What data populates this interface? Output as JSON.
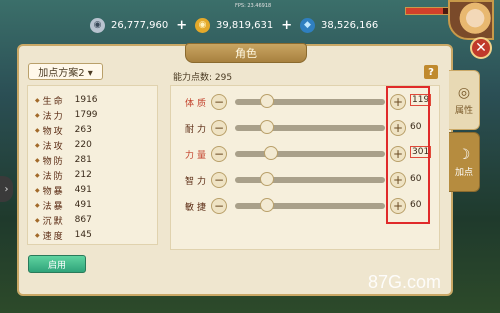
{
  "hud": {
    "fps_text": "FPS: 23.46918",
    "resources": [
      {
        "icon": "silver-coin-icon",
        "glyph": "◉",
        "color": "#b8c3cf",
        "value": "26,777,960"
      },
      {
        "icon": "gold-coin-icon",
        "glyph": "◉",
        "color": "#e4a92a",
        "value": "39,819,631"
      },
      {
        "icon": "diamond-icon",
        "glyph": "◆",
        "color": "#4aa8e0",
        "value": "38,526,166"
      }
    ],
    "plus_glyph": "+"
  },
  "panel": {
    "title": "角色",
    "close_glyph": "✕",
    "side_tabs": [
      {
        "label": "属性",
        "glyph": "◎",
        "active": false
      },
      {
        "label": "加点",
        "glyph": "☽",
        "active": true
      }
    ],
    "plan_select": "加点方案2 ▾",
    "stats": [
      {
        "name": "生命",
        "value": "1916"
      },
      {
        "name": "法力",
        "value": "1799"
      },
      {
        "name": "物攻",
        "value": "263"
      },
      {
        "name": "法攻",
        "value": "220"
      },
      {
        "name": "物防",
        "value": "281"
      },
      {
        "name": "法防",
        "value": "212"
      },
      {
        "name": "物暴",
        "value": "491"
      },
      {
        "name": "法暴",
        "value": "491"
      },
      {
        "name": "沉默",
        "value": "867"
      },
      {
        "name": "速度",
        "value": "145"
      }
    ],
    "ability_points_label": "能力点数: 295",
    "help_glyph": "?",
    "attributes": [
      {
        "name": "体质",
        "value": "119",
        "level": 0.33,
        "highlight": true
      },
      {
        "name": "耐力",
        "value": "60",
        "level": 0.33,
        "highlight": false
      },
      {
        "name": "力量",
        "value": "301",
        "level": 0.36,
        "highlight": true
      },
      {
        "name": "智力",
        "value": "60",
        "level": 0.33,
        "highlight": false
      },
      {
        "name": "敏捷",
        "value": "60",
        "level": 0.33,
        "highlight": false
      }
    ],
    "minus_glyph": "−",
    "add_glyph": "+",
    "apply_label": "启用",
    "scroll_left_glyph": "›"
  },
  "watermark": "87G.com"
}
